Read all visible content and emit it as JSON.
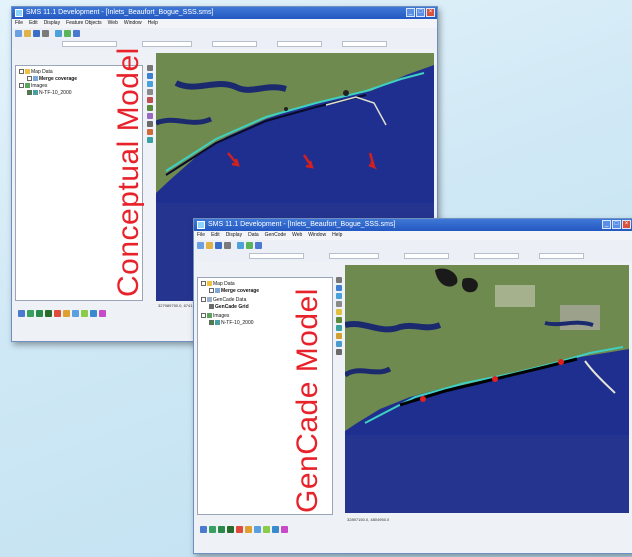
{
  "back_window": {
    "title": "SMS 11.1 Development - [Inlets_Beaufort_Bogue_SSS.sms]",
    "menu": [
      "File",
      "Edit",
      "Display",
      "Feature Objects",
      "Web",
      "Window",
      "Help"
    ],
    "tree": {
      "map_data": "Map Data",
      "coverage": "Merge coverage",
      "images": "Images",
      "image_file": "N-TF-10_2000"
    },
    "model_label": "Conceptual Model",
    "status_coords": "327989750.0, 6741..."
  },
  "front_window": {
    "title": "SMS 11.1 Development - [Inlets_Beaufort_Bogue_SSS.sms]",
    "menu": [
      "File",
      "Edit",
      "Display",
      "Data",
      "GenCode",
      "Web",
      "Window",
      "Help"
    ],
    "tree": {
      "map_data": "Map Data",
      "coverage": "Merge coverage",
      "gencade_data": "GenCade Data",
      "gencade_grid": "GenCade Grid",
      "images": "Images",
      "image_file": "N-TF-10_2000"
    },
    "model_label": "GenCade Model",
    "status_coords": "32897150.0, 4804950.0"
  },
  "colors": {
    "model_label": "#e8222a",
    "titlebar": "#2458c2",
    "ocean": "#1f2f8f",
    "land": "#6f8a4e"
  }
}
